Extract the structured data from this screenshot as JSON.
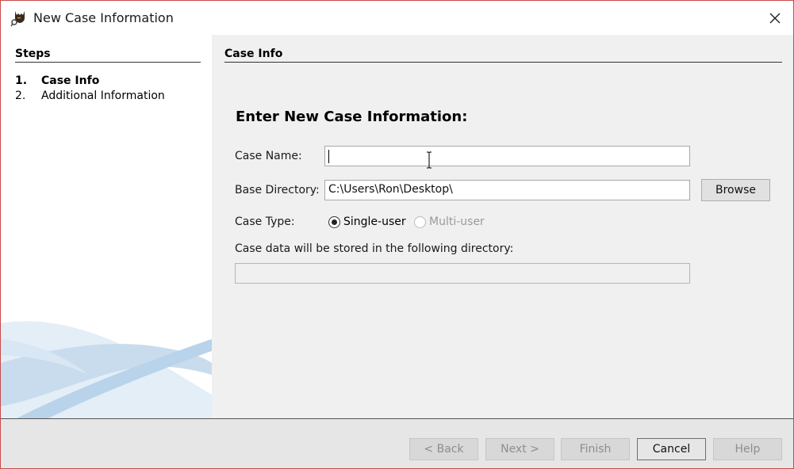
{
  "window": {
    "title": "New Case Information"
  },
  "steps": {
    "header": "Steps",
    "items": [
      {
        "num": "1.",
        "label": "Case Info"
      },
      {
        "num": "2.",
        "label": "Additional Information"
      }
    ]
  },
  "panel": {
    "title": "Case Info",
    "heading": "Enter New Case Information:",
    "case_name": {
      "label": "Case Name:",
      "value": ""
    },
    "base_directory": {
      "label": "Base Directory:",
      "value": "C:\\Users\\Ron\\Desktop\\",
      "browse": "Browse"
    },
    "case_type": {
      "label": "Case Type:",
      "options": [
        {
          "label": "Single-user",
          "selected": true,
          "enabled": true
        },
        {
          "label": "Multi-user",
          "selected": false,
          "enabled": false
        }
      ]
    },
    "stored_label": "Case data will be stored in the following directory:",
    "stored_value": ""
  },
  "footer": {
    "back": "< Back",
    "next": "Next >",
    "finish": "Finish",
    "cancel": "Cancel",
    "help": "Help"
  },
  "icons": {
    "app": "autopsy-dog-icon",
    "close": "close-icon"
  },
  "colors": {
    "window_border": "#c84a4a",
    "panel_bg": "#f0f0f0",
    "footer_bg": "#e6e6e6",
    "swoosh": "#b8d3ea"
  }
}
